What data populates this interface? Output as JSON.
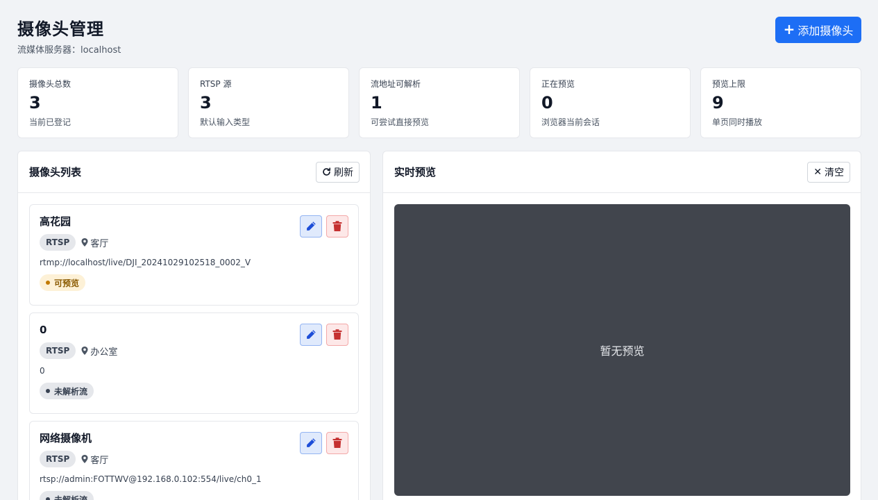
{
  "header": {
    "title": "摄像头管理",
    "subtitle": "流媒体服务器：localhost",
    "add_label": "添加摄像头"
  },
  "stats": [
    {
      "label": "摄像头总数",
      "value": "3",
      "desc": "当前已登记"
    },
    {
      "label": "RTSP 源",
      "value": "3",
      "desc": "默认输入类型"
    },
    {
      "label": "流地址可解析",
      "value": "1",
      "desc": "可尝试直接预览"
    },
    {
      "label": "正在预览",
      "value": "0",
      "desc": "浏览器当前会话"
    },
    {
      "label": "预览上限",
      "value": "9",
      "desc": "单页同时播放"
    }
  ],
  "camera_panel": {
    "title": "摄像头列表",
    "refresh_label": "刷新",
    "cameras": [
      {
        "name": "高花园",
        "type": "RTSP",
        "location": "客厅",
        "url": "rtmp://localhost/live/DJI_20241029102518_0002_V",
        "status": "可预览"
      },
      {
        "name": "0",
        "type": "RTSP",
        "location": "办公室",
        "url": "0",
        "status": "未解析流"
      },
      {
        "name": "网络摄像机",
        "type": "RTSP",
        "location": "客厅",
        "url": "rtsp://admin:FOTTWV@192.168.0.102:554/live/ch0_1",
        "status": "未解析流"
      }
    ]
  },
  "preview_panel": {
    "title": "实时预览",
    "clear_label": "清空",
    "empty_text": "暂无预览"
  },
  "colors": {
    "accent": "#1d6ef5",
    "preview_bg": "#41454d",
    "status_ok": "#c27a00",
    "delete": "#c53030"
  },
  "icons": {
    "add": "plus-icon",
    "refresh": "refresh-icon",
    "clear": "close-icon",
    "location": "map-pin-icon",
    "edit": "pencil-icon",
    "delete": "trash-icon"
  }
}
